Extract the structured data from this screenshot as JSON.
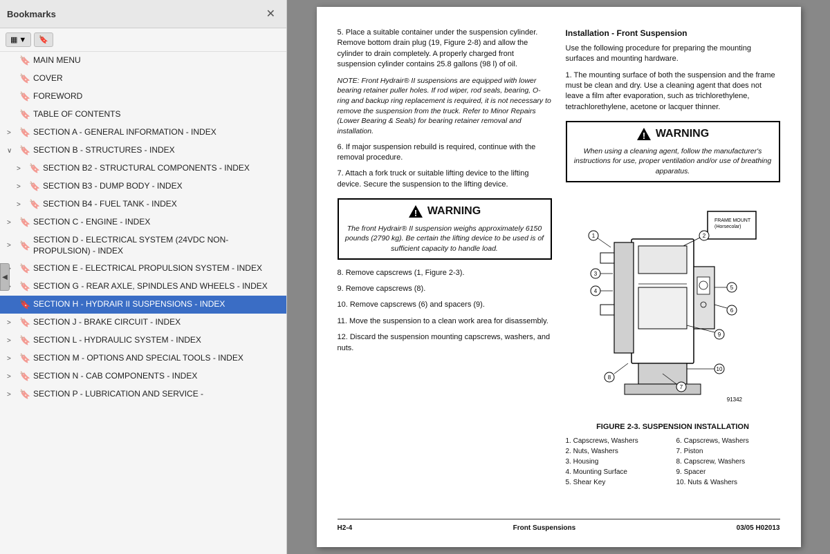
{
  "bookmarks": {
    "title": "Bookmarks",
    "close_label": "✕",
    "toolbar": {
      "dropdown_icon": "▼",
      "bookmark_icon": "🔖"
    },
    "items": [
      {
        "id": "main-menu",
        "label": "MAIN MENU",
        "level": 0,
        "expand": "",
        "selected": false
      },
      {
        "id": "cover",
        "label": "COVER",
        "level": 0,
        "expand": "",
        "selected": false
      },
      {
        "id": "foreword",
        "label": "FOREWORD",
        "level": 0,
        "expand": "",
        "selected": false
      },
      {
        "id": "toc",
        "label": "TABLE OF CONTENTS",
        "level": 0,
        "expand": "",
        "selected": false
      },
      {
        "id": "section-a",
        "label": "SECTION A - GENERAL INFORMATION - INDEX",
        "level": 0,
        "expand": ">",
        "selected": false
      },
      {
        "id": "section-b",
        "label": "SECTION B - STRUCTURES - INDEX",
        "level": 0,
        "expand": "∨",
        "selected": false
      },
      {
        "id": "section-b2",
        "label": "SECTION B2 - STRUCTURAL COMPONENTS - INDEX",
        "level": 1,
        "expand": ">",
        "selected": false
      },
      {
        "id": "section-b3",
        "label": "SECTION B3 - DUMP BODY - INDEX",
        "level": 1,
        "expand": ">",
        "selected": false
      },
      {
        "id": "section-b4",
        "label": "SECTION B4 - FUEL TANK - INDEX",
        "level": 1,
        "expand": ">",
        "selected": false
      },
      {
        "id": "section-c",
        "label": "SECTION C - ENGINE - INDEX",
        "level": 0,
        "expand": ">",
        "selected": false
      },
      {
        "id": "section-d",
        "label": "SECTION D - ELECTRICAL SYSTEM (24VDC NON-PROPULSION) - INDEX",
        "level": 0,
        "expand": ">",
        "selected": false
      },
      {
        "id": "section-e",
        "label": "SECTION E - ELECTRICAL PROPULSION SYSTEM - INDEX",
        "level": 0,
        "expand": ">",
        "selected": false
      },
      {
        "id": "section-g",
        "label": "SECTION G - REAR AXLE, SPINDLES AND WHEELS - INDEX",
        "level": 0,
        "expand": ">",
        "selected": false
      },
      {
        "id": "section-h",
        "label": "SECTION H - HYDRAIR II SUSPENSIONS - INDEX",
        "level": 0,
        "expand": "",
        "selected": true
      },
      {
        "id": "section-j",
        "label": "SECTION J - BRAKE CIRCUIT - INDEX",
        "level": 0,
        "expand": ">",
        "selected": false
      },
      {
        "id": "section-l",
        "label": "SECTION L - HYDRAULIC SYSTEM - INDEX",
        "level": 0,
        "expand": ">",
        "selected": false
      },
      {
        "id": "section-m",
        "label": "SECTION M - OPTIONS AND SPECIAL TOOLS - INDEX",
        "level": 0,
        "expand": ">",
        "selected": false
      },
      {
        "id": "section-n",
        "label": "SECTION N - CAB COMPONENTS - INDEX",
        "level": 0,
        "expand": ">",
        "selected": false
      },
      {
        "id": "section-p",
        "label": "SECTION P - LUBRICATION AND SERVICE -",
        "level": 0,
        "expand": ">",
        "selected": false
      }
    ]
  },
  "document": {
    "left_column": {
      "steps": [
        {
          "num": "5.",
          "text": "Place a suitable container under the suspension cylinder. Remove bottom drain plug (19, Figure 2-8) and allow the cylinder to drain completely. A properly charged front suspension cylinder contains 25.8 gallons (98 l) of oil."
        },
        {
          "num": "",
          "text": "NOTE: Front Hydrair® II suspensions are equipped with lower bearing retainer puller holes. If rod wiper, rod seals, bearing, O-ring and backup ring replacement is required, it is not necessary to remove the suspension from the truck. Refer to Minor Repairs (Lower Bearing & Seals) for bearing retainer removal and installation.",
          "is_note": true
        },
        {
          "num": "6.",
          "text": "If major suspension rebuild is required, continue with the removal procedure."
        },
        {
          "num": "7.",
          "text": "Attach a fork truck or suitable lifting device to the lifting device. Secure the suspension to the lifting device."
        }
      ],
      "warning": {
        "title": "⚠WARNING",
        "text": "The front Hydrair® II suspension weighs approximately 6150 pounds (2790 kg). Be certain the lifting device to be used is of sufficient capacity to handle load."
      },
      "steps2": [
        {
          "num": "8.",
          "text": "Remove capscrews (1, Figure 2-3)."
        },
        {
          "num": "9.",
          "text": "Remove capscrews (8)."
        },
        {
          "num": "10.",
          "text": "Remove capscrews (6) and spacers (9)."
        },
        {
          "num": "11.",
          "text": "Move the suspension to a clean work area for disassembly."
        },
        {
          "num": "12.",
          "text": "Discard the suspension mounting capscrews, washers, and nuts."
        }
      ]
    },
    "right_column": {
      "section_title": "Installation - Front Suspension",
      "intro": "Use the following procedure for preparing the mounting surfaces and mounting hardware.",
      "step1": "1.  The mounting surface of both the suspension and the frame must be clean and dry. Use a cleaning agent that does not leave a film after evaporation, such as trichlorethylene, tetrachlorethylene, acetone or lacquer thinner.",
      "warning": {
        "title": "⚠WARNING",
        "text": "When using a cleaning agent, follow the manufacturer's instructions for use, proper ventilation and/or use of breathing apparatus."
      },
      "figure_caption": "FIGURE 2-3. SUSPENSION INSTALLATION",
      "figure_number": "91342",
      "legend": [
        {
          "num": "1.",
          "text": "Capscrews, Washers"
        },
        {
          "num": "6.",
          "text": "Capscrews, Washers"
        },
        {
          "num": "2.",
          "text": "Nuts, Washers"
        },
        {
          "num": "7.",
          "text": "Piston"
        },
        {
          "num": "3.",
          "text": "Housing"
        },
        {
          "num": "8.",
          "text": "Capscrew, Washers"
        },
        {
          "num": "4.",
          "text": "Mounting Surface"
        },
        {
          "num": "9.",
          "text": "Spacer"
        },
        {
          "num": "5.",
          "text": "Shear Key"
        },
        {
          "num": "10.",
          "text": "Nuts & Washers"
        }
      ],
      "diagram_labels": {
        "frame_mount": "FRAME MOUNT (Horsecolar)"
      }
    },
    "footer": {
      "left": "H2-4",
      "center": "Front Suspensions",
      "right": "03/05  H02013"
    }
  }
}
